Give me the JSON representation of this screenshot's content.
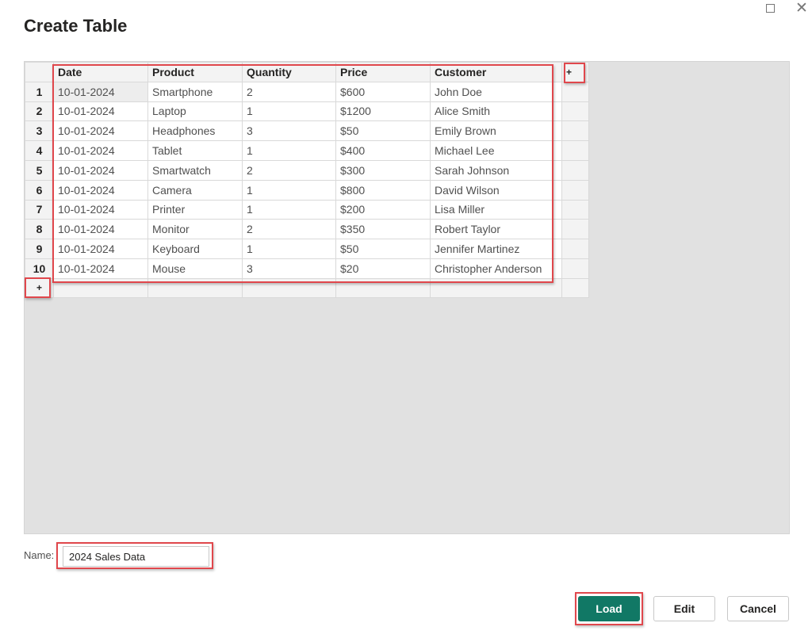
{
  "dialog": {
    "title": "Create Table",
    "window_controls": {
      "maximize_icon": "maximize-icon",
      "close_icon": "close-icon"
    }
  },
  "grid": {
    "columns": [
      "Date",
      "Product",
      "Quantity",
      "Price",
      "Customer"
    ],
    "add_column_label": "+",
    "add_row_label": "+",
    "rows": [
      {
        "num": "1",
        "cells": [
          "10-01-2024",
          "Smartphone",
          "2",
          "$600",
          "John Doe"
        ]
      },
      {
        "num": "2",
        "cells": [
          "10-01-2024",
          "Laptop",
          "1",
          "$1200",
          "Alice Smith"
        ]
      },
      {
        "num": "3",
        "cells": [
          "10-01-2024",
          "Headphones",
          "3",
          "$50",
          "Emily Brown"
        ]
      },
      {
        "num": "4",
        "cells": [
          "10-01-2024",
          "Tablet",
          "1",
          "$400",
          "Michael Lee"
        ]
      },
      {
        "num": "5",
        "cells": [
          "10-01-2024",
          "Smartwatch",
          "2",
          "$300",
          "Sarah Johnson"
        ]
      },
      {
        "num": "6",
        "cells": [
          "10-01-2024",
          "Camera",
          "1",
          "$800",
          "David Wilson"
        ]
      },
      {
        "num": "7",
        "cells": [
          "10-01-2024",
          "Printer",
          "1",
          "$200",
          "Lisa Miller"
        ]
      },
      {
        "num": "8",
        "cells": [
          "10-01-2024",
          "Monitor",
          "2",
          "$350",
          "Robert Taylor"
        ]
      },
      {
        "num": "9",
        "cells": [
          "10-01-2024",
          "Keyboard",
          "1",
          "$50",
          "Jennifer Martinez"
        ]
      },
      {
        "num": "10",
        "cells": [
          "10-01-2024",
          "Mouse",
          "3",
          "$20",
          "Christopher Anderson"
        ]
      }
    ],
    "selected_cell": {
      "row": 1,
      "column": "Date"
    }
  },
  "name_field": {
    "label": "Name:",
    "value": "2024 Sales Data"
  },
  "buttons": {
    "load": "Load",
    "edit": "Edit",
    "cancel": "Cancel"
  },
  "colors": {
    "primary": "#117865",
    "highlight": "#e0474c"
  }
}
